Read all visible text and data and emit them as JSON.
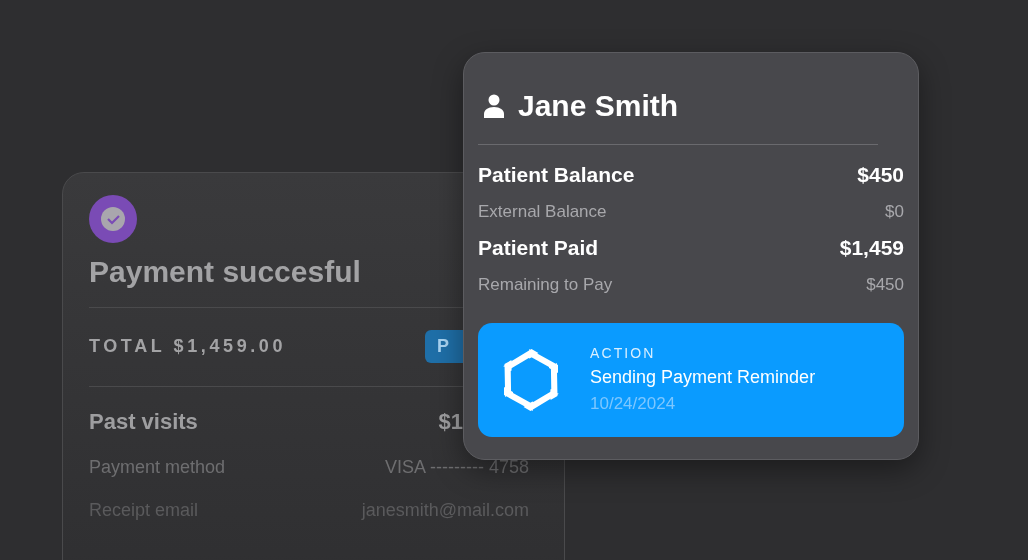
{
  "receipt_card": {
    "checked": true,
    "title": "Payment succesful",
    "total": "TOTAL $1,459.00",
    "badge": "P",
    "past_visits": {
      "label": "Past visits",
      "amount": "$1"
    },
    "details": [
      {
        "label": "Payment method",
        "value": "VISA --------- 4758"
      },
      {
        "label": "Receipt email",
        "value": "janesmith@mail.com"
      }
    ]
  },
  "patient_card": {
    "name": "Jane Smith",
    "rows": [
      {
        "kind": "primary",
        "label": "Patient Balance",
        "value": "$450"
      },
      {
        "kind": "secondary",
        "label": "External Balance",
        "value": "$0"
      },
      {
        "kind": "primary",
        "label": "Patient Paid",
        "value": "$1,459"
      },
      {
        "kind": "secondary",
        "label": "Remaining to Pay",
        "value": "$450"
      }
    ],
    "action": {
      "label": "ACTION",
      "title": "Sending Payment Reminder",
      "date": "10/24/2024"
    }
  }
}
